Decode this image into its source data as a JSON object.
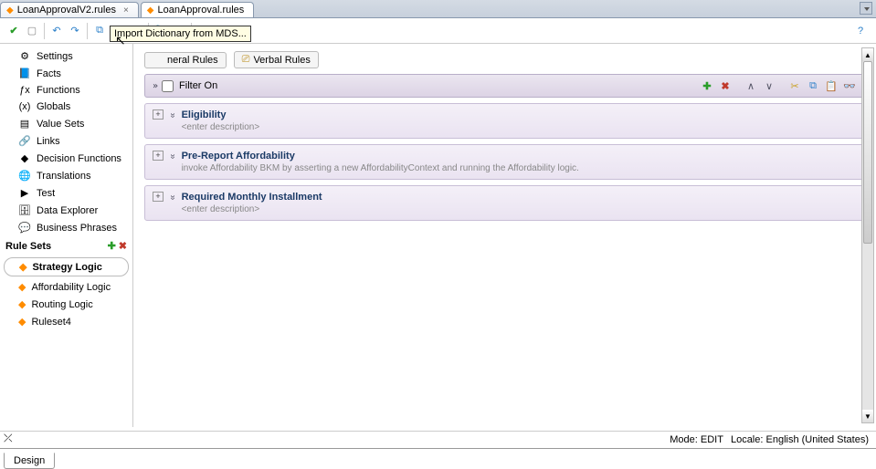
{
  "tabs": [
    {
      "label": "LoanApprovalV2.rules",
      "active": false
    },
    {
      "label": "LoanApproval.rules",
      "active": true
    }
  ],
  "tooltip": "Import Dictionary from MDS...",
  "sidebar": {
    "items": [
      {
        "icon": "settings-icon",
        "glyph": "⚙",
        "label": "Settings"
      },
      {
        "icon": "facts-icon",
        "glyph": "📘",
        "label": "Facts"
      },
      {
        "icon": "functions-icon",
        "glyph": "ƒx",
        "label": "Functions"
      },
      {
        "icon": "globals-icon",
        "glyph": "(x)",
        "label": "Globals"
      },
      {
        "icon": "valuesets-icon",
        "glyph": "▤",
        "label": "Value Sets"
      },
      {
        "icon": "links-icon",
        "glyph": "🔗",
        "label": "Links"
      },
      {
        "icon": "decisionfn-icon",
        "glyph": "◆",
        "label": "Decision Functions"
      },
      {
        "icon": "translations-icon",
        "glyph": "🌐",
        "label": "Translations"
      },
      {
        "icon": "test-icon",
        "glyph": "▶",
        "label": "Test"
      },
      {
        "icon": "dataexplorer-icon",
        "glyph": "🗄",
        "label": "Data Explorer"
      },
      {
        "icon": "bizphrases-icon",
        "glyph": "💬",
        "label": "Business Phrases"
      }
    ],
    "rulesets_label": "Rule Sets",
    "rulesets": [
      {
        "label": "Strategy Logic",
        "active": true
      },
      {
        "label": "Affordability Logic",
        "active": false
      },
      {
        "label": "Routing Logic",
        "active": false
      },
      {
        "label": "Ruleset4",
        "active": false
      }
    ]
  },
  "subtabs": {
    "general": "neral Rules",
    "verbal": "Verbal Rules"
  },
  "filter": {
    "label": "Filter On"
  },
  "rules": [
    {
      "title": "Eligibility",
      "desc": "<enter description>"
    },
    {
      "title": "Pre-Report Affordability",
      "desc": "invoke Affordability BKM by asserting a new AffordabilityContext and running the Affordability logic."
    },
    {
      "title": "Required Monthly Installment",
      "desc": "<enter description>"
    }
  ],
  "status": {
    "mode_label": "Mode:",
    "mode_value": "EDIT",
    "locale_label": "Locale:",
    "locale_value": "English (United States)"
  },
  "footer_tab": "Design"
}
